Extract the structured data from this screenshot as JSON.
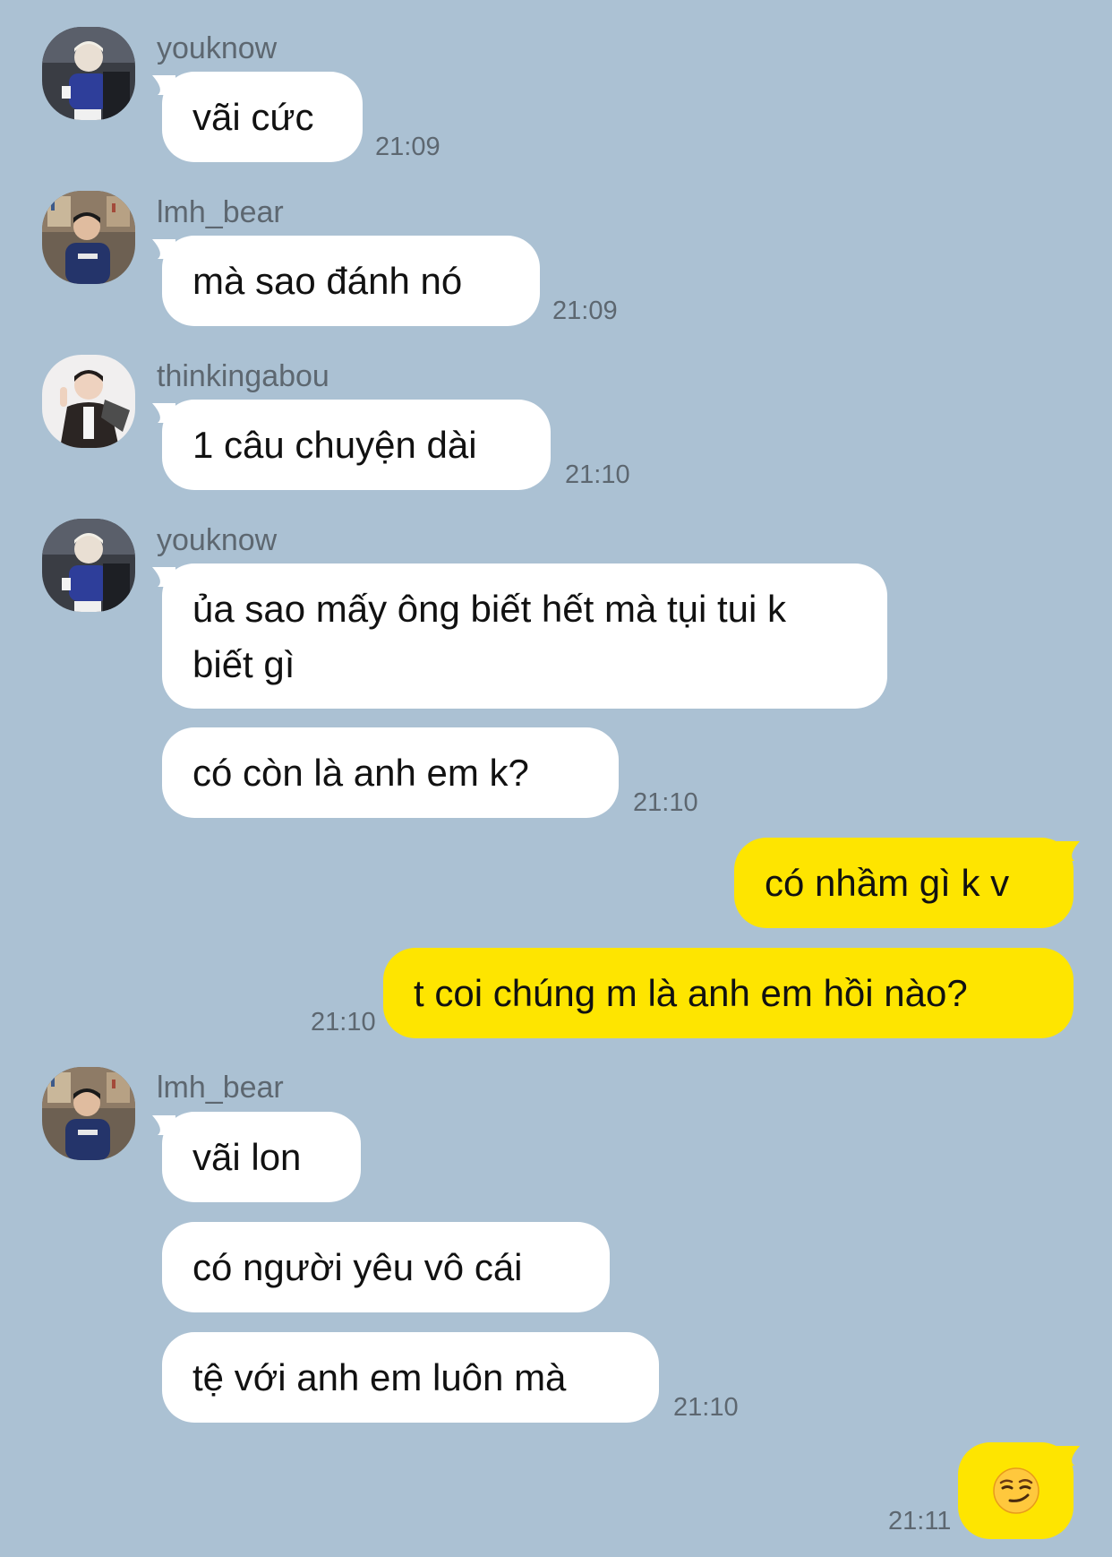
{
  "colors": {
    "background": "#abc1d3",
    "incoming": "#ffffff",
    "outgoing": "#fee500",
    "meta_text": "#5d6770"
  },
  "messages": [
    {
      "sender": "youknow",
      "avatar": "avatar-youknow",
      "texts": [
        "vãi cức"
      ],
      "time": "21:09"
    },
    {
      "sender": "lmh_bear",
      "avatar": "avatar-lmh_bear",
      "texts": [
        "mà sao đánh nó"
      ],
      "time": "21:09"
    },
    {
      "sender": "thinkingabou",
      "avatar": "avatar-thinkingabou",
      "texts": [
        "1 câu chuyện dài"
      ],
      "time": "21:10"
    },
    {
      "sender": "youknow",
      "avatar": "avatar-youknow",
      "texts": [
        "ủa sao mấy ông biết hết mà tụi tui k biết gì",
        "có còn là anh em k?"
      ],
      "time": "21:10"
    },
    {
      "sender": "me",
      "texts": [
        "có nhầm gì k v",
        "t coi chúng m là anh em hồi nào?"
      ],
      "time": "21:10"
    },
    {
      "sender": "lmh_bear",
      "avatar": "avatar-lmh_bear",
      "texts": [
        "vãi lon",
        "có người yêu vô cái",
        "tệ với anh em luôn mà"
      ],
      "time": "21:10"
    },
    {
      "sender": "me",
      "texts": [
        "😏"
      ],
      "emoji_icon": "smirking-face-icon",
      "time": "21:11"
    }
  ]
}
